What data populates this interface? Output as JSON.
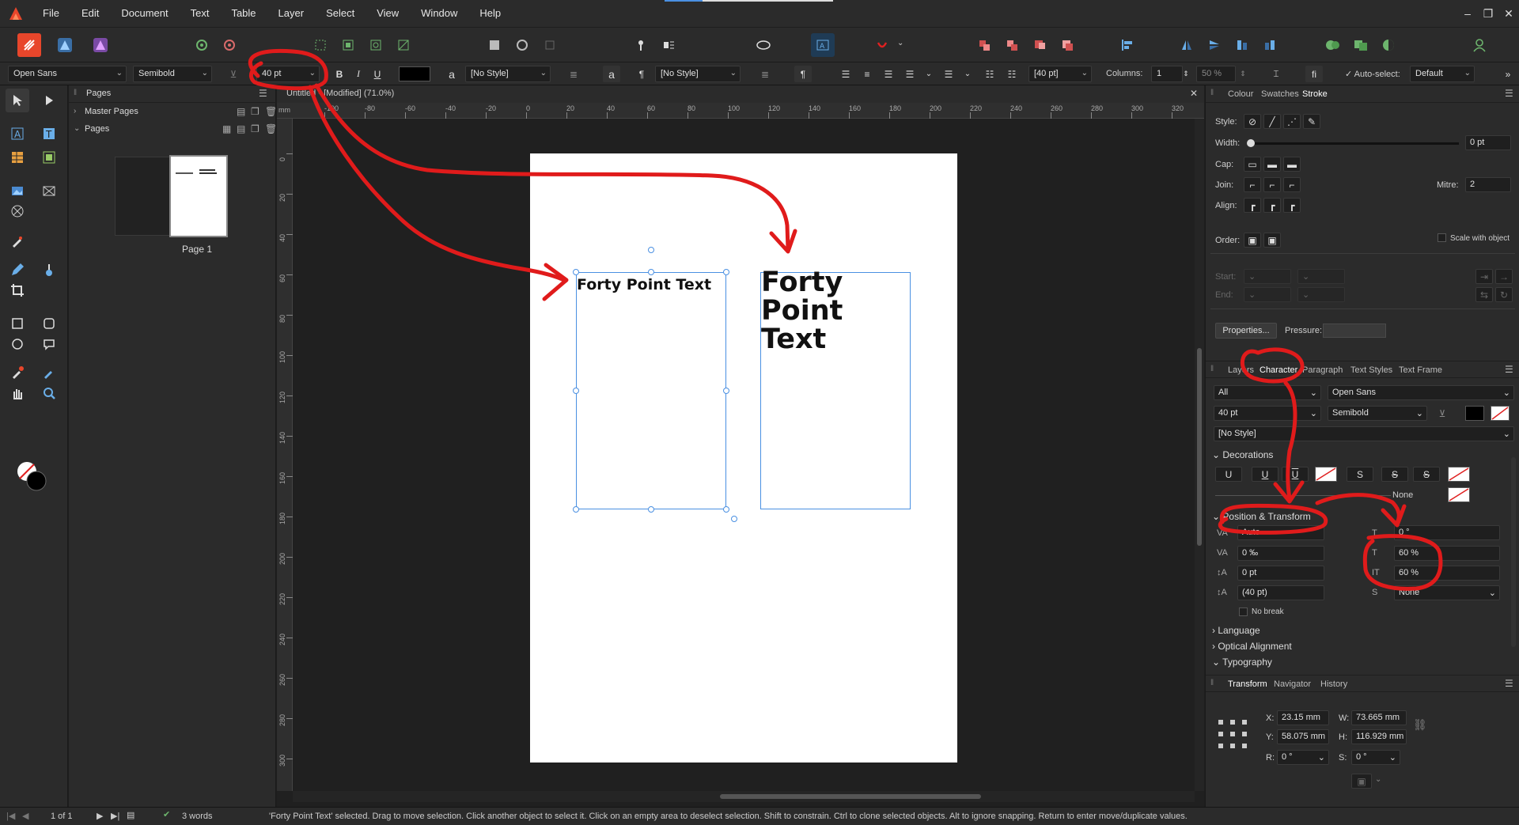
{
  "menubar": {
    "items": [
      "File",
      "Edit",
      "Document",
      "Text",
      "Table",
      "Layer",
      "Select",
      "View",
      "Window",
      "Help"
    ]
  },
  "context_bar": {
    "font_family": "Open Sans",
    "font_style": "Semibold",
    "font_size": "40 pt",
    "char_style": "[No Style]",
    "para_style": "[No Style]",
    "leading": "[40 pt]",
    "columns_label": "Columns:",
    "columns_value": "1",
    "zoom_value": "50 %",
    "fi_label": "fi",
    "autoselect_label": "Auto-select:",
    "autoselect_value": "Default"
  },
  "doc_tab": {
    "title": "Untitled - [Modified] (71.0%)"
  },
  "rulers": {
    "unit": "mm",
    "h_ticks": [
      "-100",
      "-80",
      "-60",
      "-40",
      "-20",
      "0",
      "20",
      "40",
      "60",
      "80",
      "100",
      "120",
      "140",
      "160",
      "180",
      "200",
      "220",
      "240",
      "260",
      "280",
      "300",
      "320"
    ],
    "v_ticks": [
      "0",
      "20",
      "40",
      "60",
      "80",
      "100",
      "120",
      "140",
      "160",
      "180",
      "200",
      "220",
      "240",
      "260",
      "280",
      "300"
    ]
  },
  "pages_panel": {
    "title": "Pages",
    "master_pages": "Master Pages",
    "pages": "Pages",
    "page_label": "Page 1"
  },
  "canvas": {
    "frame1_text": "Forty Point Text",
    "frame2_text": "Forty Point Text"
  },
  "stroke_panel": {
    "tabs": [
      "Colour",
      "Swatches",
      "Stroke"
    ],
    "style_label": "Style:",
    "width_label": "Width:",
    "width_value": "0 pt",
    "cap_label": "Cap:",
    "join_label": "Join:",
    "mitre_label": "Mitre:",
    "mitre_value": "2",
    "align_label": "Align:",
    "order_label": "Order:",
    "scale_label": "Scale with object",
    "start_label": "Start:",
    "end_label": "End:",
    "properties_button": "Properties...",
    "pressure_label": "Pressure:"
  },
  "character_panel": {
    "tabs": [
      "Layers",
      "Character",
      "Paragraph",
      "Text Styles",
      "Text Frame"
    ],
    "scope": "All",
    "font": "Open Sans",
    "size": "40 pt",
    "weight": "Semibold",
    "style": "[No Style]",
    "decorations": "Decorations",
    "underline_none": "None",
    "position_transform": "Position & Transform",
    "kerning": "Auto",
    "tracking": "0 ‰",
    "baseline": "0 pt",
    "leading": "(40 pt)",
    "shear": "0 °",
    "vscale": "60 %",
    "hscale": "60 %",
    "script": "None",
    "no_break": "No break",
    "language": "Language",
    "optical": "Optical Alignment",
    "typography": "Typography"
  },
  "transform_panel": {
    "tabs": [
      "Transform",
      "Navigator",
      "History"
    ],
    "x": "23.15 mm",
    "y": "58.075 mm",
    "w": "73.665 mm",
    "h": "116.929 mm",
    "r": "0 °",
    "s": "0 °",
    "x_label": "X:",
    "y_label": "Y:",
    "w_label": "W:",
    "h_label": "H:",
    "r_label": "R:",
    "s_label": "S:"
  },
  "status": {
    "page_of": "1 of 1",
    "words": "3 words",
    "message": "'Forty Point Text' selected. Drag to move selection. Click another object to select it. Click on an empty area to deselect selection. Shift to constrain. Ctrl to clone selected objects. Alt to ignore snapping. Return to enter move/duplicate values."
  },
  "colors": {
    "brand": "#e8462b",
    "selection": "#4a90e2",
    "annotation": "#e01b1b"
  }
}
